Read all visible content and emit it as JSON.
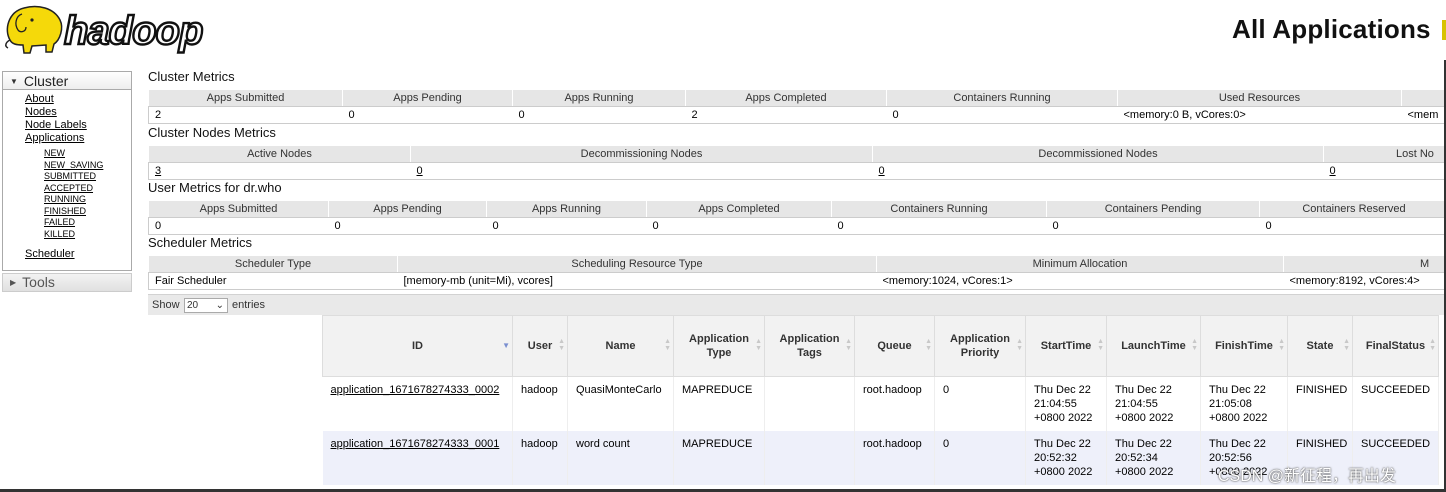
{
  "header": {
    "logo_text": "hadoop",
    "title": "All Applications"
  },
  "sidebar": {
    "cluster_label": "Cluster",
    "links": [
      "About",
      "Nodes",
      "Node Labels",
      "Applications"
    ],
    "app_states": [
      "NEW",
      "NEW_SAVING",
      "SUBMITTED",
      "ACCEPTED",
      "RUNNING",
      "FINISHED",
      "FAILED",
      "KILLED"
    ],
    "scheduler_label": "Scheduler",
    "tools_label": "Tools"
  },
  "cluster_metrics": {
    "title": "Cluster Metrics",
    "headers": [
      "Apps Submitted",
      "Apps Pending",
      "Apps Running",
      "Apps Completed",
      "Containers Running",
      "Used Resources",
      ""
    ],
    "values": [
      "2",
      "0",
      "0",
      "2",
      "0",
      "<memory:0 B, vCores:0>",
      "<mem"
    ]
  },
  "cluster_nodes_metrics": {
    "title": "Cluster Nodes Metrics",
    "headers": [
      "Active Nodes",
      "Decommissioning Nodes",
      "Decommissioned Nodes",
      "Lost No"
    ],
    "values": [
      "3",
      "0",
      "0",
      "0"
    ]
  },
  "user_metrics": {
    "title": "User Metrics for dr.who",
    "headers": [
      "Apps Submitted",
      "Apps Pending",
      "Apps Running",
      "Apps Completed",
      "Containers Running",
      "Containers Pending",
      "Containers Reserved"
    ],
    "values": [
      "0",
      "0",
      "0",
      "0",
      "0",
      "0",
      "0"
    ]
  },
  "scheduler_metrics": {
    "title": "Scheduler Metrics",
    "headers": [
      "Scheduler Type",
      "Scheduling Resource Type",
      "Minimum Allocation",
      "M"
    ],
    "values": [
      "Fair Scheduler",
      "[memory-mb (unit=Mi), vcores]",
      "<memory:1024, vCores:1>",
      "<memory:8192, vCores:4>"
    ]
  },
  "apps": {
    "show_label": "Show",
    "entries_value": "20",
    "entries_label": "entries",
    "columns": [
      "ID",
      "User",
      "Name",
      "Application Type",
      "Application Tags",
      "Queue",
      "Application Priority",
      "StartTime",
      "LaunchTime",
      "FinishTime",
      "State",
      "FinalStatus"
    ],
    "rows": [
      {
        "id": "application_1671678274333_0002",
        "user": "hadoop",
        "name": "QuasiMonteCarlo",
        "type": "MAPREDUCE",
        "tags": "",
        "queue": "root.hadoop",
        "priority": "0",
        "start": [
          "Thu Dec 22",
          "21:04:55",
          "+0800 2022"
        ],
        "launch": [
          "Thu Dec 22",
          "21:04:55",
          "+0800 2022"
        ],
        "finish": [
          "Thu Dec 22",
          "21:05:08",
          "+0800 2022"
        ],
        "state": "FINISHED",
        "final_status": "SUCCEEDED"
      },
      {
        "id": "application_1671678274333_0001",
        "user": "hadoop",
        "name": "word count",
        "type": "MAPREDUCE",
        "tags": "",
        "queue": "root.hadoop",
        "priority": "0",
        "start": [
          "Thu Dec 22",
          "20:52:32",
          "+0800 2022"
        ],
        "launch": [
          "Thu Dec 22",
          "20:52:34",
          "+0800 2022"
        ],
        "finish": [
          "Thu Dec 22",
          "20:52:56",
          "+0800 2022"
        ],
        "state": "FINISHED",
        "final_status": "SUCCEEDED"
      }
    ]
  },
  "watermark": "CSDN @新征程，再出发",
  "colors": {
    "logo_yellow": "#f5d90a",
    "header_gray": "#e6e6e6",
    "even_row": "#eef0fa"
  }
}
